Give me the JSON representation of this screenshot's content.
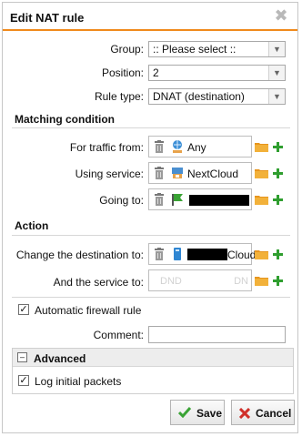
{
  "dialog": {
    "title": "Edit NAT rule"
  },
  "group": {
    "label": "Group:",
    "value": ":: Please select ::"
  },
  "position": {
    "label": "Position:",
    "value": "2"
  },
  "rule_type": {
    "label": "Rule type:",
    "value": "DNAT (destination)"
  },
  "matching": {
    "heading": "Matching condition",
    "traffic_from": {
      "label": "For traffic from:",
      "value": "Any"
    },
    "using_service": {
      "label": "Using service:",
      "value": "NextCloud"
    },
    "going_to": {
      "label": "Going to:",
      "value": ""
    }
  },
  "action": {
    "heading": "Action",
    "change_destination": {
      "label": "Change the destination to:",
      "value": "Cloud"
    },
    "and_service": {
      "label": "And the service to:",
      "placeholder_left": "DND",
      "placeholder_right": "DN"
    }
  },
  "auto_firewall": {
    "label": "Automatic firewall rule",
    "checked": true
  },
  "comment": {
    "label": "Comment:",
    "value": ""
  },
  "advanced": {
    "heading": "Advanced",
    "log_initial": {
      "label": "Log initial packets",
      "checked": true
    }
  },
  "buttons": {
    "save": "Save",
    "cancel": "Cancel"
  },
  "colors": {
    "accent": "#f08a1c",
    "add": "#2f9e2f",
    "cancel_icon": "#d0302a",
    "save_icon": "#3aa335"
  }
}
